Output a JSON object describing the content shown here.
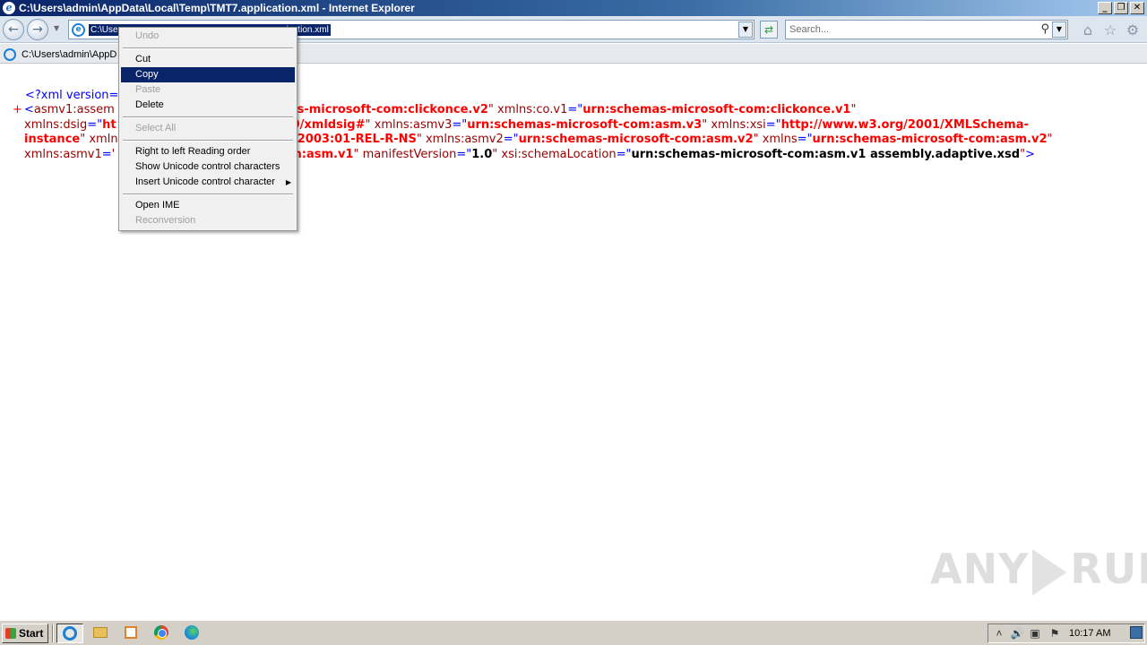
{
  "window": {
    "title": "C:\\Users\\admin\\AppData\\Local\\Temp\\TMT7.application.xml - Internet Explorer",
    "controls": {
      "minimize": "_",
      "maximize": "❐",
      "close": "✕"
    }
  },
  "navbar": {
    "address_selected_start": "C:\\Use",
    "address_selected_end": "ication.xml",
    "search_placeholder": "Search..."
  },
  "tab": {
    "label": "C:\\Users\\admin\\AppD"
  },
  "xml": {
    "pi": "<?xml version=",
    "l1": {
      "plus": "+",
      "open": "<",
      "tag_visible": "asmv1:assem",
      "v1_tail": "as-microsoft-com:clickonce.v2",
      "a2": "xmlns:co.v1",
      "v2": "urn:schemas-microsoft-com:clickonce.v1"
    },
    "l2": {
      "a1": "xmlns:dsig",
      "v1_head": "ht",
      "v1_tail": "9/xmldsig#",
      "a2": "xmlns:asmv3",
      "v2": "urn:schemas-microsoft-com:asm.v3",
      "a3": "xmlns:xsi",
      "v3": "http://www.w3.org/2001/XMLSchema-"
    },
    "l3": {
      "v3_cont": "instance",
      "a1_head": "xmln",
      "v1_tail": ":2003:01-REL-R-NS",
      "a2": "xmlns:asmv2",
      "v2": "urn:schemas-microsoft-com:asm.v2",
      "a3": "xmlns",
      "v3": "urn:schemas-microsoft-com:asm.v2"
    },
    "l4": {
      "a1": "xmlns:asmv1",
      "v1_head": "'",
      "v1_tail": "m:asm.v1",
      "a2": "manifestVersion",
      "v2": "1.0",
      "a3": "xsi:schemaLocation",
      "v3": "urn:schemas-microsoft-com:asm.v1 assembly.adaptive.xsd",
      "close": ">"
    }
  },
  "context_menu": {
    "undo": "Undo",
    "cut": "Cut",
    "copy": "Copy",
    "paste": "Paste",
    "delete": "Delete",
    "select_all": "Select All",
    "rtl": "Right to left Reading order",
    "show_unicode": "Show Unicode control characters",
    "insert_unicode": "Insert Unicode control character",
    "open_ime": "Open IME",
    "reconversion": "Reconversion"
  },
  "watermark": {
    "left": "ANY",
    "right": "RUN"
  },
  "taskbar": {
    "start": "Start",
    "clock": "10:17 AM"
  },
  "colors": {
    "title_bar": "#0a246a",
    "xml_value": "#ff0000",
    "xml_attr": "#990000",
    "xml_punct": "#0000ff",
    "menu_highlight": "#0a246a"
  }
}
